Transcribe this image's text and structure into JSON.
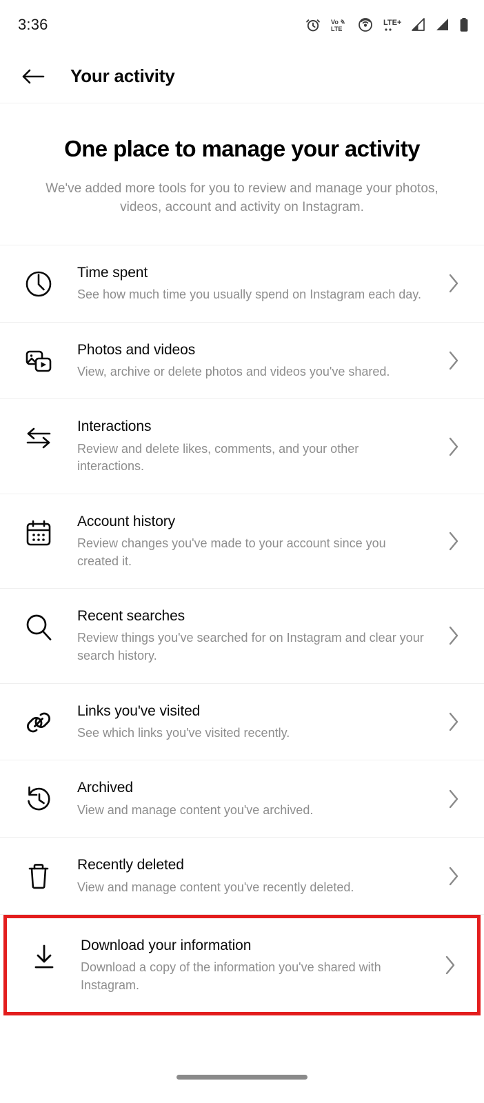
{
  "status_bar": {
    "time": "3:36",
    "icons": [
      "alarm-icon",
      "volte-icon",
      "hotspot-icon",
      "lte-plus-icon",
      "signal-bars-1-icon",
      "signal-bars-2-icon",
      "battery-icon"
    ]
  },
  "app_bar": {
    "back_label": "back-arrow-icon",
    "title": "Your activity"
  },
  "hero": {
    "title": "One place to manage your activity",
    "subtitle": "We've added more tools for you to review and manage your photos, videos, account and activity on Instagram."
  },
  "list": {
    "items": [
      {
        "icon": "clock-icon",
        "title": "Time spent",
        "subtitle": "See how much time you usually spend on Instagram each day.",
        "highlighted": false
      },
      {
        "icon": "photos-videos-icon",
        "title": "Photos and videos",
        "subtitle": "View, archive or delete photos and videos you've shared.",
        "highlighted": false
      },
      {
        "icon": "interactions-arrows-icon",
        "title": "Interactions",
        "subtitle": "Review and delete likes, comments, and your other interactions.",
        "highlighted": false
      },
      {
        "icon": "calendar-icon",
        "title": "Account history",
        "subtitle": "Review changes you've made to your account since you created it.",
        "highlighted": false
      },
      {
        "icon": "search-icon",
        "title": "Recent searches",
        "subtitle": "Review things you've searched for on Instagram and clear your search history.",
        "highlighted": false
      },
      {
        "icon": "link-icon",
        "title": "Links you've visited",
        "subtitle": "See which links you've visited recently.",
        "highlighted": false
      },
      {
        "icon": "history-rewind-icon",
        "title": "Archived",
        "subtitle": "View and manage content you've archived.",
        "highlighted": false
      },
      {
        "icon": "trash-icon",
        "title": "Recently deleted",
        "subtitle": "View and manage content you've recently deleted.",
        "highlighted": false
      },
      {
        "icon": "download-icon",
        "title": "Download your information",
        "subtitle": "Download a copy of the information you've shared with Instagram.",
        "highlighted": true
      }
    ],
    "chevron_icon": "chevron-right-icon"
  },
  "colors": {
    "highlight_border": "#e31d1d",
    "title_text": "#0a0a0a",
    "subtitle_text": "#8e8e8e",
    "divider": "#efefef"
  },
  "gesture_bar": {
    "label": "home-gesture-pill"
  }
}
